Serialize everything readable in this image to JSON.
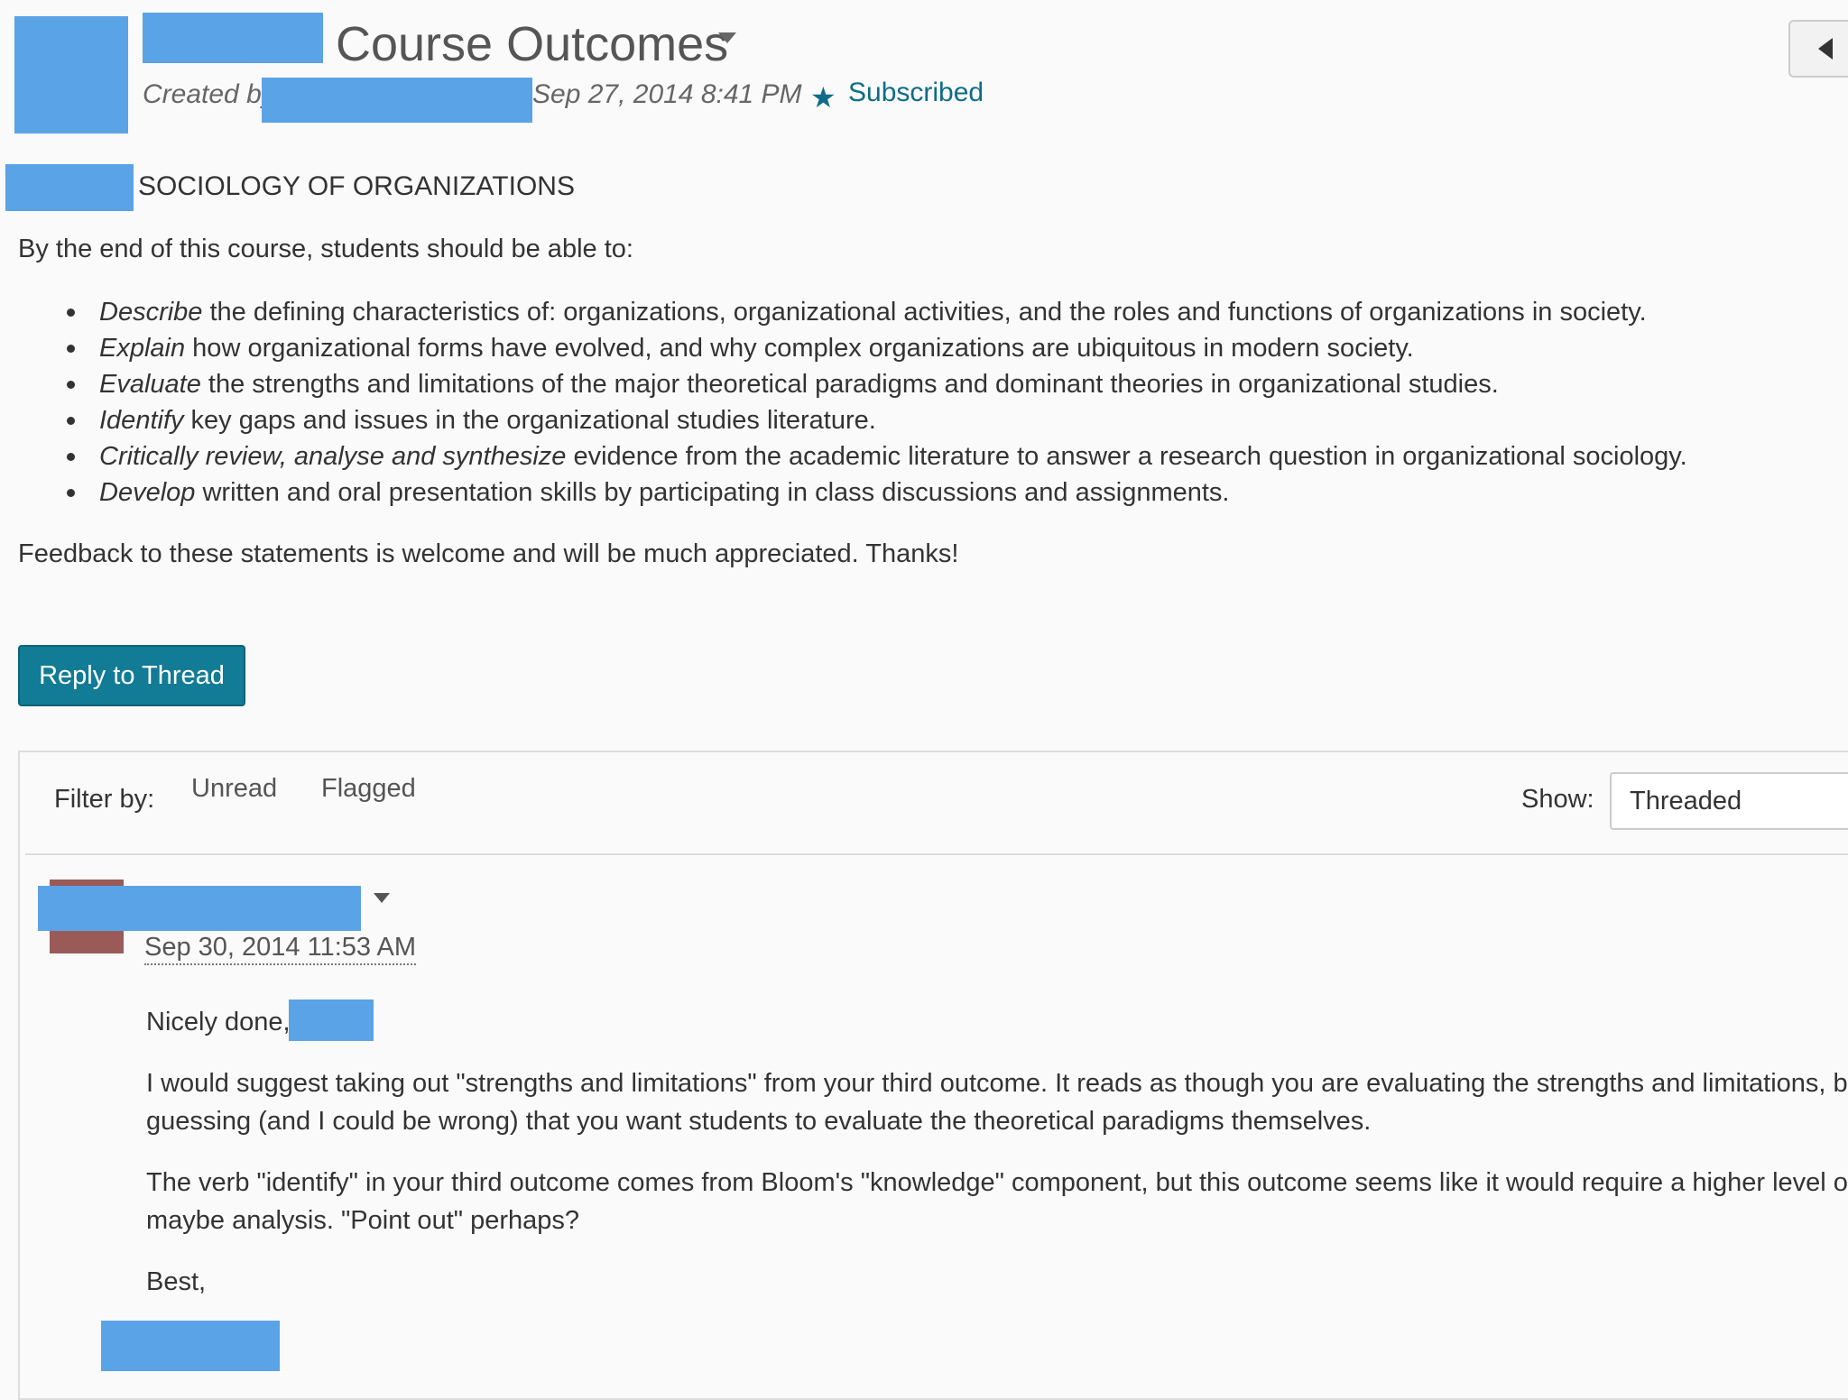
{
  "header": {
    "title": "Course Outcomes",
    "created_by_label": "Created by",
    "posted_date": "Sep 27, 2014 8:41 PM",
    "subscription_status": "Subscribed"
  },
  "post": {
    "course_name": "SOCIOLOGY OF ORGANIZATIONS",
    "intro": "By the end of this course, students should be able to:",
    "outcomes": [
      {
        "verb": "Describe",
        "rest": " the defining characteristics of: organizations, organizational activities, and the roles and functions of organizations in society."
      },
      {
        "verb": "Explain",
        "rest": " how organizational forms have evolved, and why complex organizations are ubiquitous in modern society."
      },
      {
        "verb": "Evaluate",
        "rest": " the strengths and limitations of the major theoretical paradigms and dominant theories in organizational studies."
      },
      {
        "verb": "Identify",
        "rest": " key gaps and issues in the organizational studies literature."
      },
      {
        "verb": "Critically review, analyse and synthesize",
        "rest": " evidence from the academic literature to answer a research question in organizational sociology."
      },
      {
        "verb": "Develop",
        "rest": " written and oral presentation skills by participating in class discussions and assignments."
      }
    ],
    "closing": "Feedback to these statements is welcome and will be much appreciated. Thanks!"
  },
  "actions": {
    "reply_button": "Reply to Thread"
  },
  "filter": {
    "label": "Filter by:",
    "options": [
      "Unread",
      "Flagged"
    ],
    "show_label": "Show:",
    "show_value": "Threaded"
  },
  "reply": {
    "date": "Sep 30, 2014 11:53 AM",
    "greeting": "Nicely done,",
    "para1_line1": "I would suggest taking out \"strengths and limitations\" from your third outcome. It reads as though you are evaluating the strengths and limitations, b",
    "para1_line2": "guessing (and I could be wrong) that you want students to evaluate the theoretical paradigms themselves.",
    "para2_line1": "The verb \"identify\" in your third outcome comes from Bloom's \"knowledge\" component, but this outcome seems like it would require a higher level of",
    "para2_line2": "maybe analysis. \"Point out\" perhaps?",
    "signoff": "Best,"
  },
  "icons": {
    "star": "star-icon",
    "title_menu": "chevron-down-icon",
    "collapse": "caret-left-icon"
  },
  "colors": {
    "accent": "#127b95",
    "link": "#0e6c8b",
    "redaction": "#5aa3e6"
  }
}
